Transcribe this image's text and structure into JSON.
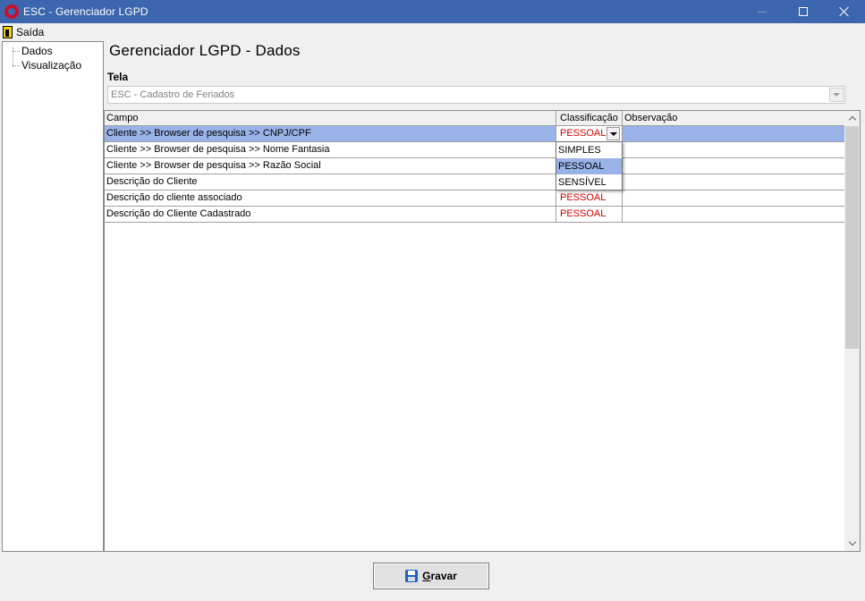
{
  "window": {
    "title": "ESC - Gerenciador LGPD"
  },
  "menu": {
    "exit_label": "Saída"
  },
  "tree": {
    "items": [
      "Dados",
      "Visualização"
    ]
  },
  "page": {
    "title": "Gerenciador LGPD - Dados",
    "tela_label": "Tela",
    "tela_value": "ESC - Cadastro de Feriados"
  },
  "grid": {
    "columns": [
      "Campo",
      "Classificação",
      "Observação"
    ],
    "rows": [
      {
        "campo": "Cliente >> Browser de pesquisa >> CNPJ/CPF",
        "classificacao": "PESSOAL",
        "observacao": ""
      },
      {
        "campo": "Cliente >> Browser de pesquisa >> Nome Fantasia",
        "classificacao": "",
        "observacao": ""
      },
      {
        "campo": "Cliente >> Browser de pesquisa >> Razão Social",
        "classificacao": "",
        "observacao": ""
      },
      {
        "campo": "Descrição do Cliente",
        "classificacao": "",
        "observacao": ""
      },
      {
        "campo": "Descrição do cliente associado",
        "classificacao": "PESSOAL",
        "observacao": ""
      },
      {
        "campo": "Descrição do Cliente Cadastrado",
        "classificacao": "PESSOAL",
        "observacao": ""
      }
    ],
    "selected_row": 0
  },
  "dropdown": {
    "options": [
      "SIMPLES",
      "PESSOAL",
      "SENSÍVEL"
    ],
    "highlighted": "PESSOAL"
  },
  "save_button": {
    "label_first": "G",
    "label_rest": "ravar"
  },
  "colors": {
    "titlebar": "#3c66ad",
    "selection": "#99b2e8",
    "classification_text": "#d00000"
  }
}
